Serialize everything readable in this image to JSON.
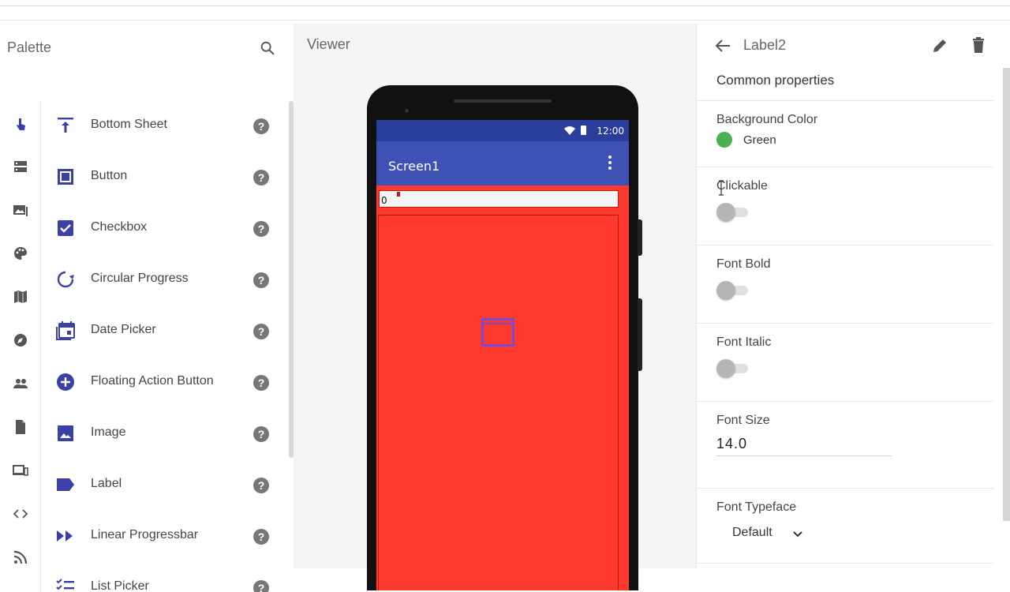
{
  "palette": {
    "title": "Palette",
    "categories": [
      "user-interface-icon",
      "layout-icon",
      "media-icon",
      "drawing-icon",
      "maps-icon",
      "sensors-icon",
      "social-icon",
      "storage-icon",
      "connectivity-icon",
      "lego-icon",
      "experimental-icon"
    ],
    "components": [
      {
        "label": "Bottom Sheet",
        "icon": "bottom-sheet-icon"
      },
      {
        "label": "Button",
        "icon": "button-icon"
      },
      {
        "label": "Checkbox",
        "icon": "checkbox-icon"
      },
      {
        "label": "Circular Progress",
        "icon": "circular-progress-icon"
      },
      {
        "label": "Date Picker",
        "icon": "date-picker-icon"
      },
      {
        "label": "Floating Action Button",
        "icon": "floating-action-button-icon"
      },
      {
        "label": "Image",
        "icon": "image-icon"
      },
      {
        "label": "Label",
        "icon": "label-icon"
      },
      {
        "label": "Linear Progressbar",
        "icon": "linear-progressbar-icon"
      },
      {
        "label": "List Picker",
        "icon": "list-picker-icon"
      }
    ],
    "help_glyph": "?"
  },
  "viewer": {
    "title": "Viewer",
    "status_time": "12:00",
    "screen_title": "Screen1",
    "label_text": "0",
    "colors": {
      "screen_bg": "#fe3a2d",
      "statusbar": "#2c3e9c",
      "appbar": "#3f51b5"
    }
  },
  "properties": {
    "component_name": "Label2",
    "section_title": "Common properties",
    "background_color_label": "Background Color",
    "background_color_value": "Green",
    "background_color_hex": "#4caf50",
    "clickable_label": "Clickable",
    "clickable_on": false,
    "font_bold_label": "Font Bold",
    "font_bold_on": false,
    "font_italic_label": "Font Italic",
    "font_italic_on": false,
    "font_size_label": "Font Size",
    "font_size_value": "14.0",
    "font_typeface_label": "Font Typeface",
    "font_typeface_value": "Default"
  }
}
